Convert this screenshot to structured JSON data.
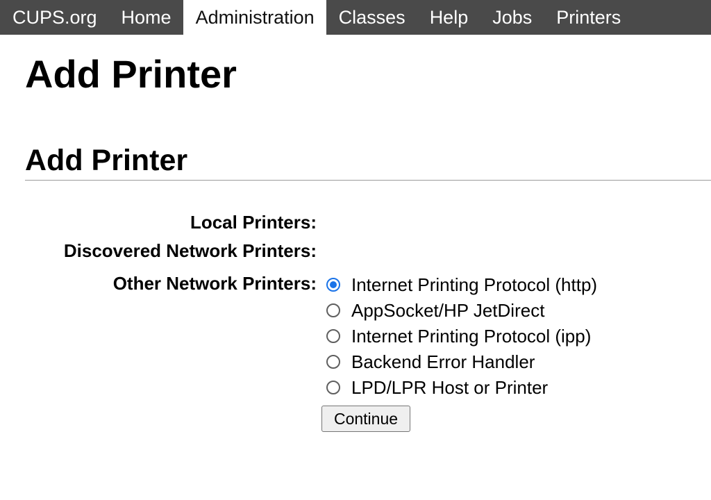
{
  "nav": {
    "items": [
      {
        "label": "CUPS.org",
        "active": false
      },
      {
        "label": "Home",
        "active": false
      },
      {
        "label": "Administration",
        "active": true
      },
      {
        "label": "Classes",
        "active": false
      },
      {
        "label": "Help",
        "active": false
      },
      {
        "label": "Jobs",
        "active": false
      },
      {
        "label": "Printers",
        "active": false
      }
    ]
  },
  "page": {
    "title": "Add Printer",
    "section_title": "Add Printer"
  },
  "form": {
    "local_label": "Local Printers:",
    "discovered_label": "Discovered Network Printers:",
    "other_label": "Other Network Printers:",
    "options": [
      {
        "label": "Internet Printing Protocol (http)",
        "checked": true
      },
      {
        "label": "AppSocket/HP JetDirect",
        "checked": false
      },
      {
        "label": "Internet Printing Protocol (ipp)",
        "checked": false
      },
      {
        "label": "Backend Error Handler",
        "checked": false
      },
      {
        "label": "LPD/LPR Host or Printer",
        "checked": false
      }
    ],
    "continue_label": "Continue"
  },
  "colors": {
    "nav_background": "#4a4a4a",
    "radio_accent": "#1a73e8"
  }
}
